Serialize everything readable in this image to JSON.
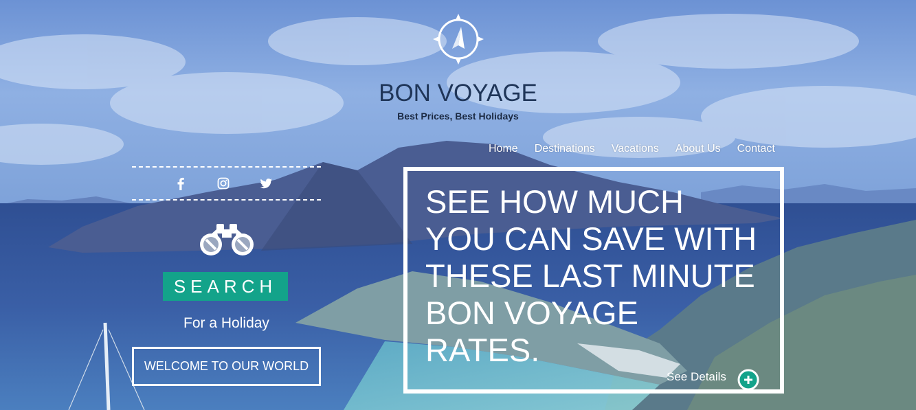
{
  "brand": {
    "title": "BON VOYAGE",
    "tagline": "Best Prices, Best Holidays",
    "logo_icon": "compass-icon"
  },
  "nav": {
    "items": [
      {
        "label": "Home"
      },
      {
        "label": "Destinations"
      },
      {
        "label": "Vacations"
      },
      {
        "label": "About Us"
      },
      {
        "label": "Contact"
      }
    ]
  },
  "social": {
    "icons": [
      "facebook-icon",
      "instagram-icon",
      "twitter-icon"
    ]
  },
  "search": {
    "icon": "binoculars-icon",
    "button_label": "SEARCH",
    "subtitle": "For a Holiday"
  },
  "welcome": {
    "button_label": "WELCOME TO OUR WORLD"
  },
  "promo": {
    "lines": [
      "SEE HOW MUCH",
      "YOU CAN SAVE WITH",
      "THESE LAST MINUTE",
      "BON VOYAGE",
      "RATES."
    ],
    "details_label": "See Details",
    "plus_icon": "plus-circle-icon"
  },
  "colors": {
    "accent": "#13a38a",
    "title": "#1f3558",
    "text_light": "#ffffff"
  }
}
